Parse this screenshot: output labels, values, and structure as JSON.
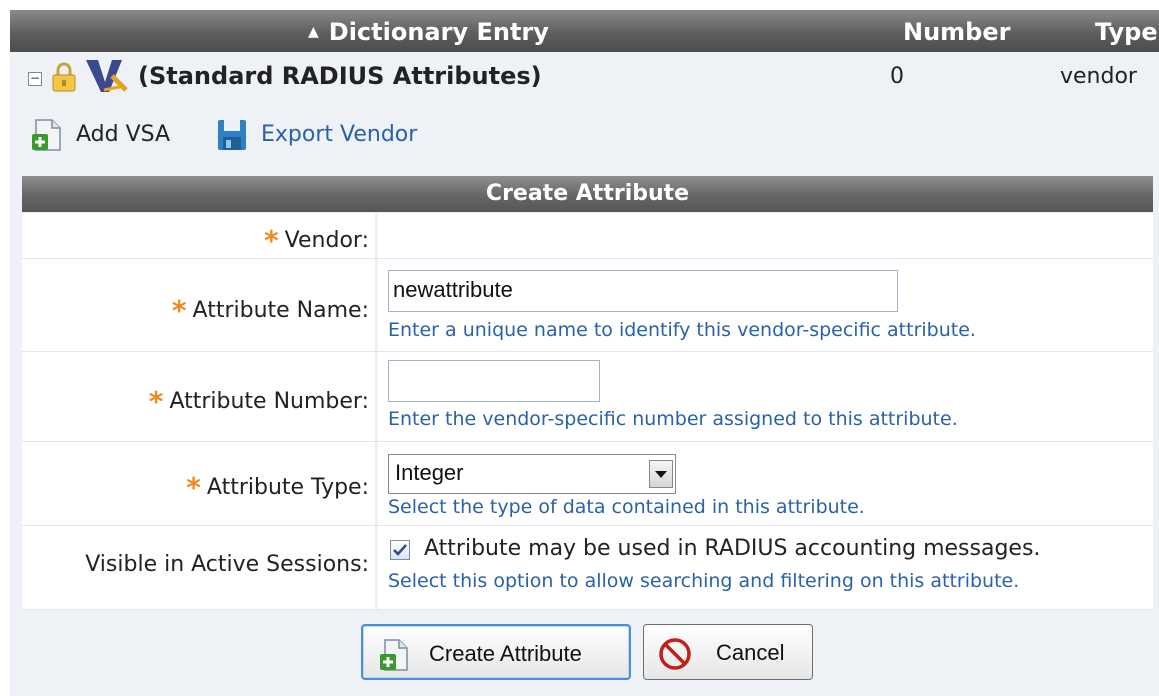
{
  "table": {
    "sort_arrow": "▲",
    "headers": {
      "entry": "Dictionary Entry",
      "number": "Number",
      "type": "Type"
    },
    "vendor_row": {
      "toggle": "−",
      "name": "(Standard RADIUS Attributes)",
      "number": "0",
      "type": "vendor"
    }
  },
  "actions": {
    "add_vsa": "Add VSA",
    "export_vendor": "Export Vendor"
  },
  "form": {
    "title": "Create Attribute",
    "required_mark": "*",
    "vendor_label": "Vendor:",
    "name_label": "Attribute Name:",
    "name_value": "newattribute",
    "name_hint": "Enter a unique name to identify this vendor-specific attribute.",
    "number_label": "Attribute Number:",
    "number_value": "",
    "number_hint": "Enter the vendor-specific number assigned to this attribute.",
    "type_label": "Attribute Type:",
    "type_value": "Integer",
    "type_hint": "Select the type of data contained in this attribute.",
    "visible_label": "Visible in Active Sessions:",
    "visible_checked": true,
    "visible_option": "Attribute may be used in RADIUS accounting messages.",
    "visible_hint": "Select this option to allow searching and filtering on this attribute.",
    "create_button": "Create Attribute",
    "cancel_button": "Cancel"
  },
  "colors": {
    "header_bg": "#5e5e5e",
    "required": "#f08a1d",
    "hint": "#2a62a8",
    "row_bg": "#eef1f5"
  }
}
